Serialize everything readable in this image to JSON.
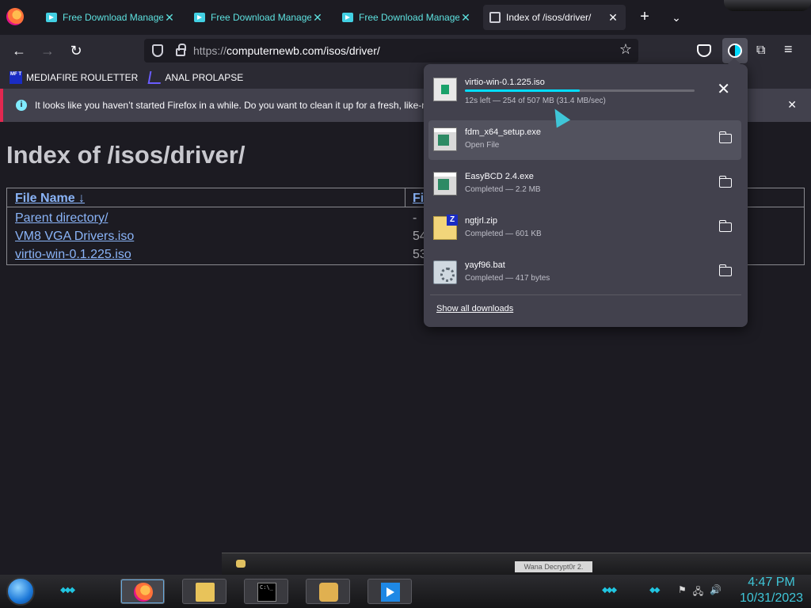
{
  "tabs": [
    {
      "title": "Free Download Manager",
      "close": "✕"
    },
    {
      "title": "Free Download Manager",
      "close": "✕"
    },
    {
      "title": "Free Download Manager",
      "close": "✕"
    },
    {
      "title": "Index of /isos/driver/",
      "close": "✕"
    }
  ],
  "tabstrip": {
    "new_tab": "+",
    "list_all": "⌄"
  },
  "nav": {
    "back": "←",
    "forward": "→",
    "reload": "↻",
    "url_scheme": "https://",
    "url_rest": "computernewb.com/isos/driver/",
    "star": "☆",
    "extensions": "⧉",
    "menu": "≡"
  },
  "bookmarks": [
    {
      "label": "MEDIAFIRE ROULETTER",
      "icon": "MF T"
    },
    {
      "label": "ANAL PROLAPSE"
    }
  ],
  "notification": {
    "icon": "i",
    "text": "It looks like you haven’t started Firefox in a while. Do you want to clean it up for a fresh, like-n",
    "close": "✕"
  },
  "page": {
    "title": "Index of /isos/driver/",
    "headers": {
      "name": "File Name  ↓",
      "size": "Fi"
    },
    "rows": [
      {
        "name": "Parent directory/",
        "size": "-"
      },
      {
        "name": "VM8 VGA Drivers.iso",
        "size": "54"
      },
      {
        "name": "virtio-win-0.1.225.iso",
        "size": "53"
      }
    ]
  },
  "downloads": {
    "active": {
      "name": "virtio-win-0.1.225.iso",
      "status": "12s left — 254 of 507 MB (31.4 MB/sec)",
      "progress": 0.5,
      "cancel": "✕"
    },
    "items": [
      {
        "name": "fdm_x64_setup.exe",
        "status": "Open File"
      },
      {
        "name": "EasyBCD 2.4.exe",
        "status": "Completed — 2.2 MB"
      },
      {
        "name": "ngtjrl.zip",
        "status": "Completed — 601 KB"
      },
      {
        "name": "yayf96.bat",
        "status": "Completed — 417 bytes"
      }
    ],
    "show_all": "Show all downloads"
  },
  "taskbar": {
    "tooltip": "Wana Decrypt0r 2.",
    "cmd_text": "C:\\_",
    "clock_time": "4:47 PM",
    "clock_date": "10/31/2023",
    "tray": [
      "⚑",
      "🖧",
      "🔊"
    ]
  },
  "colors": {
    "accent": "#00ddff",
    "link": "#8ab4f8",
    "tab_accent": "#5ee2e0",
    "notify_border": "#e22850"
  }
}
